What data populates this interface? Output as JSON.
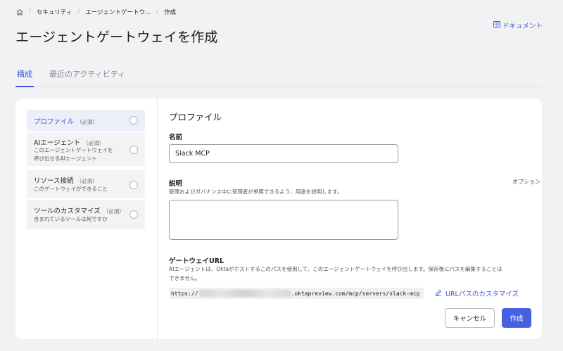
{
  "breadcrumb": {
    "home_icon": "home-icon",
    "items": [
      "セキュリティ",
      "エージェントゲートウ...",
      "作成"
    ]
  },
  "header": {
    "title": "エージェントゲートウェイを作成",
    "doc_link": "ドキュメント",
    "doc_icon": "book-icon"
  },
  "tabs": [
    {
      "label": "構成",
      "active": true
    },
    {
      "label": "最近のアクティビティ",
      "active": false
    }
  ],
  "steps": [
    {
      "title": "プロファイル",
      "req": "（必須）",
      "desc": [],
      "active": true
    },
    {
      "title": "AIエージェント",
      "req": "（必須）",
      "desc": [
        "このエージェントゲートウェイを",
        "呼び出せるAIエージェント"
      ],
      "active": false
    },
    {
      "title": "リソース接続",
      "req": "（必須）",
      "desc": [
        "このゲートウェイができること"
      ],
      "active": false
    },
    {
      "title": "ツールのカスタマイズ",
      "req": "（必須）",
      "desc": [
        "含まれているツールは何ですか"
      ],
      "active": false
    }
  ],
  "form": {
    "section_title": "プロファイル",
    "name_label": "名前",
    "name_value": "Slack MCP",
    "desc_label": "説明",
    "desc_optional": "オプション",
    "desc_help": "管理およびガバナンス中に管理者が参照できるよう、用途を説明します。",
    "url_label": "ゲートウェイURL",
    "url_help_1": "AIエージェントは、Oktaがホストするこのパスを使用して、このエージェントゲートウェイを呼び出します。保存後にパスを編集することは",
    "url_help_2": "できません。",
    "url_prefix": "https://",
    "url_suffix": ".oktapreview.com/mcp/servers/slack-mcp",
    "customize_link": "URLパスのカスタマイズ",
    "customize_icon": "pencil-icon"
  },
  "buttons": {
    "cancel": "キャンセル",
    "create": "作成"
  },
  "colors": {
    "accent": "#3b5bdb",
    "primary_button": "#4661e0",
    "background": "#f2f2f4"
  }
}
